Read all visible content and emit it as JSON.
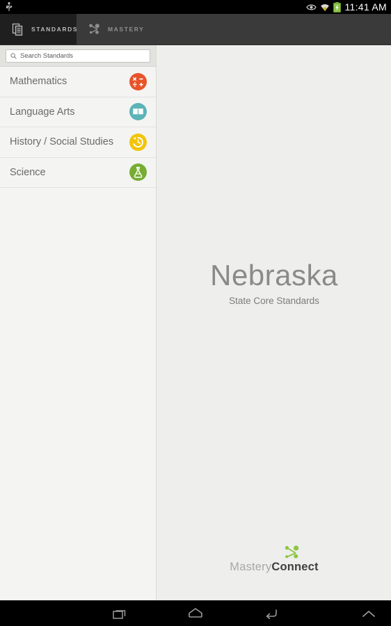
{
  "statusbar": {
    "time": "11:41 AM",
    "icons": [
      "usb-icon",
      "eye-icon",
      "wifi-icon",
      "battery-icon"
    ]
  },
  "tabs": [
    {
      "label": "STANDARDS",
      "icon": "documents-icon",
      "active": true
    },
    {
      "label": "MASTERY",
      "icon": "node-graph-icon",
      "active": false
    }
  ],
  "search": {
    "placeholder": "Search Standards",
    "value": "",
    "icon": "search-icon"
  },
  "sidebar": {
    "items": [
      {
        "label": "Mathematics",
        "icon": "math-operators-icon",
        "color": "#e8532a"
      },
      {
        "label": "Language Arts",
        "icon": "open-book-icon",
        "color": "#5cb3b8"
      },
      {
        "label": "History / Social Studies",
        "icon": "clock-history-icon",
        "color": "#f2c40c"
      },
      {
        "label": "Science",
        "icon": "flask-icon",
        "color": "#76ad32"
      }
    ]
  },
  "main": {
    "title": "Nebraska",
    "subtitle": "State Core Standards"
  },
  "brand": {
    "name_light": "Mastery",
    "name_bold": "Connect",
    "logo_icon": "node-graph-icon",
    "logo_color": "#8cc63f"
  },
  "navbar": {
    "buttons": [
      {
        "name": "recents",
        "icon": "recents-icon"
      },
      {
        "name": "home",
        "icon": "home-icon"
      },
      {
        "name": "back",
        "icon": "back-icon"
      },
      {
        "name": "expand",
        "icon": "chevron-up-icon"
      }
    ]
  },
  "colors": {
    "accent_green": "#8cc63f",
    "tabbar_bg": "#3a3a3a",
    "tab_active_bg": "#1f1f1f",
    "sidebar_bg": "#f4f4f2",
    "main_bg": "#eeeeec"
  }
}
